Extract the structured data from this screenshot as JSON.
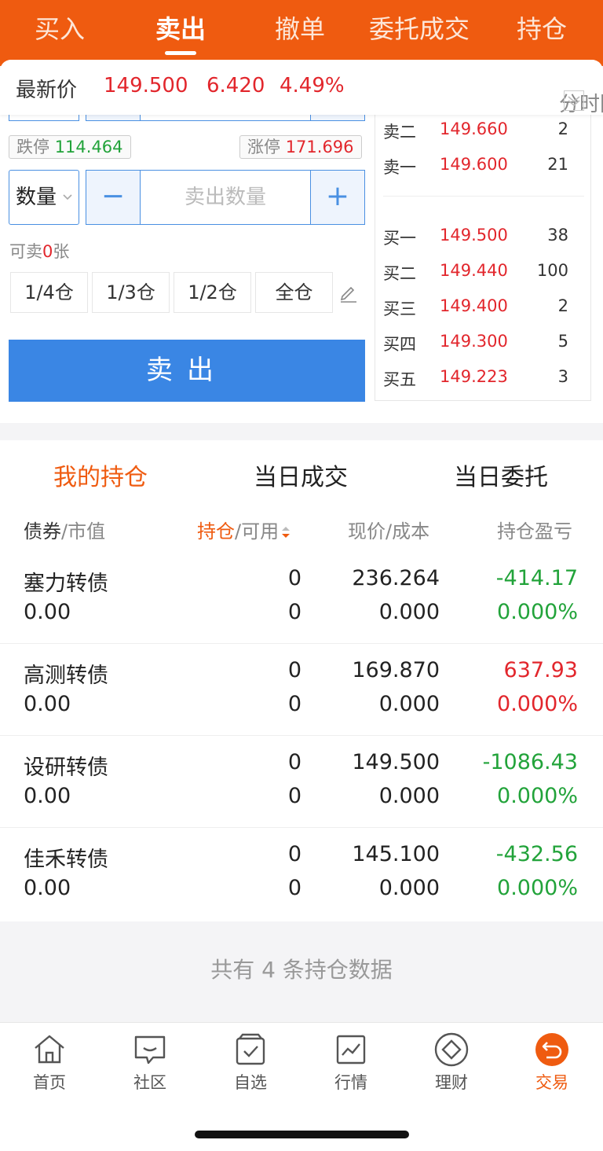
{
  "top_tabs": [
    {
      "label": "买入"
    },
    {
      "label": "卖出"
    },
    {
      "label": "撤单"
    },
    {
      "label": "委托成交"
    },
    {
      "label": "持仓"
    }
  ],
  "price_bar": {
    "label": "最新价",
    "price": "149.500",
    "change": "6.420",
    "change_pct": "4.49%",
    "chart_label": "分时图"
  },
  "order_form": {
    "limit_down_label": "跌停",
    "limit_down": "114.464",
    "limit_up_label": "涨停",
    "limit_up": "171.696",
    "qty_type": "数量",
    "minus": "−",
    "plus": "+",
    "qty_placeholder": "卖出数量",
    "avail_prefix": "可卖",
    "avail_count": "0",
    "avail_unit": "张",
    "ratios": [
      "1/4仓",
      "1/3仓",
      "1/2仓",
      "全仓"
    ],
    "sell_label": "卖出"
  },
  "order_book": {
    "asks": [
      {
        "label": "卖二",
        "price": "149.660",
        "vol": "2"
      },
      {
        "label": "卖一",
        "price": "149.600",
        "vol": "21"
      }
    ],
    "bids": [
      {
        "label": "买一",
        "price": "149.500",
        "vol": "38"
      },
      {
        "label": "买二",
        "price": "149.440",
        "vol": "100"
      },
      {
        "label": "买三",
        "price": "149.400",
        "vol": "2"
      },
      {
        "label": "买四",
        "price": "149.300",
        "vol": "5"
      },
      {
        "label": "买五",
        "price": "149.223",
        "vol": "3"
      }
    ]
  },
  "holdings_tabs": [
    {
      "label": "我的持仓"
    },
    {
      "label": "当日成交"
    },
    {
      "label": "当日委托"
    }
  ],
  "columns": {
    "c1a": "债券",
    "c1b": "市值",
    "c2a": "持仓",
    "c2b": "可用",
    "c3a": "现价",
    "c3b": "成本",
    "c4": "持仓盈亏",
    "sep": "/"
  },
  "rows": [
    {
      "name": "塞力转债",
      "mv": "0.00",
      "pos": "0",
      "avail": "0",
      "price": "236.264",
      "cost": "0.000",
      "pnl": "-414.17",
      "pnl_pct": "0.000%",
      "tone": "green"
    },
    {
      "name": "高测转债",
      "mv": "0.00",
      "pos": "0",
      "avail": "0",
      "price": "169.870",
      "cost": "0.000",
      "pnl": "637.93",
      "pnl_pct": "0.000%",
      "tone": "red"
    },
    {
      "name": "设研转债",
      "mv": "0.00",
      "pos": "0",
      "avail": "0",
      "price": "149.500",
      "cost": "0.000",
      "pnl": "-1086.43",
      "pnl_pct": "0.000%",
      "tone": "green"
    },
    {
      "name": "佳禾转债",
      "mv": "0.00",
      "pos": "0",
      "avail": "0",
      "price": "145.100",
      "cost": "0.000",
      "pnl": "-432.56",
      "pnl_pct": "0.000%",
      "tone": "green"
    }
  ],
  "footer_note": "共有 4 条持仓数据",
  "bottom_nav": [
    {
      "label": "首页",
      "icon": "home-icon"
    },
    {
      "label": "社区",
      "icon": "chat-icon"
    },
    {
      "label": "自选",
      "icon": "watchlist-icon"
    },
    {
      "label": "行情",
      "icon": "market-chart-icon"
    },
    {
      "label": "理财",
      "icon": "diamond-icon"
    },
    {
      "label": "交易",
      "icon": "trade-icon"
    }
  ],
  "colors": {
    "brand": "#ef5b10",
    "up": "#e2262c",
    "down": "#22a33a",
    "primary_button": "#3a86e4"
  }
}
